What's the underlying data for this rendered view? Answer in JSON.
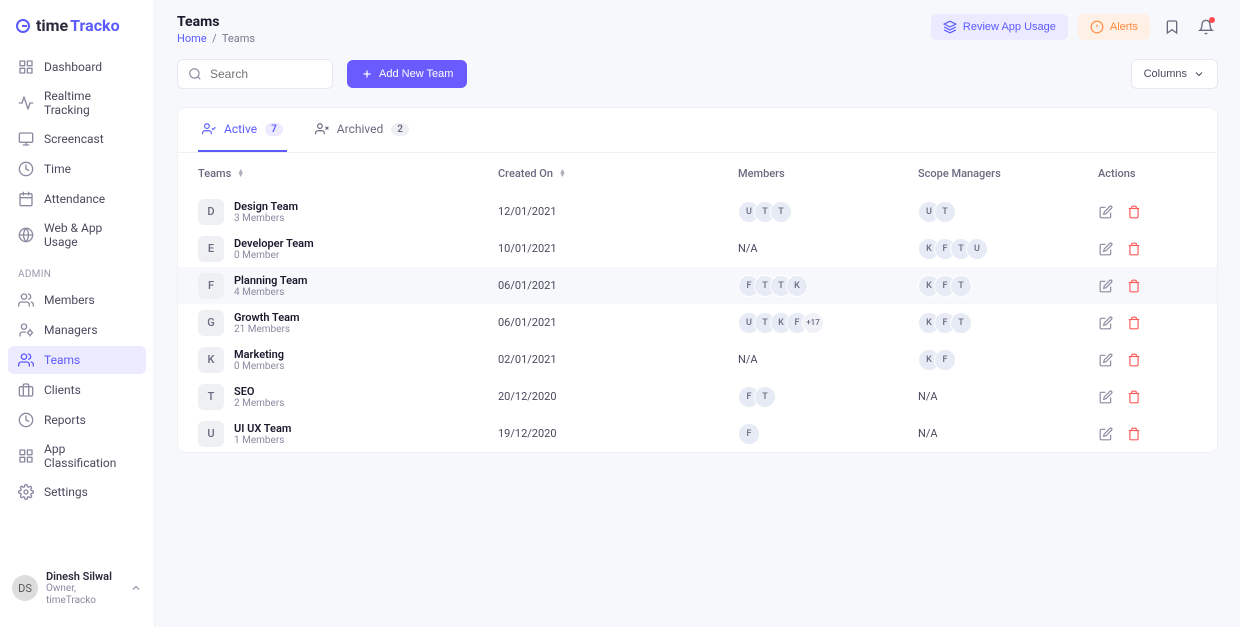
{
  "brand": {
    "part1": "time",
    "part2": "Tracko"
  },
  "nav": {
    "main": [
      {
        "label": "Dashboard",
        "icon": "grid"
      },
      {
        "label": "Realtime Tracking",
        "icon": "activity"
      },
      {
        "label": "Screencast",
        "icon": "monitor"
      },
      {
        "label": "Time",
        "icon": "clock"
      },
      {
        "label": "Attendance",
        "icon": "calendar"
      },
      {
        "label": "Web & App Usage",
        "icon": "globe"
      }
    ],
    "adminLabel": "ADMIN",
    "admin": [
      {
        "label": "Members",
        "icon": "users"
      },
      {
        "label": "Managers",
        "icon": "user-cog"
      },
      {
        "label": "Teams",
        "icon": "team",
        "active": true
      },
      {
        "label": "Clients",
        "icon": "briefcase"
      },
      {
        "label": "Reports",
        "icon": "reports"
      },
      {
        "label": "App Classification",
        "icon": "apps"
      },
      {
        "label": "Settings",
        "icon": "gear"
      }
    ]
  },
  "user": {
    "name": "Dinesh Silwal",
    "role": "Owner, timeTracko",
    "initials": "DS"
  },
  "page": {
    "title": "Teams",
    "breadcrumb": {
      "home": "Home",
      "sep": "/",
      "current": "Teams"
    }
  },
  "topActions": {
    "review": "Review App Usage",
    "alerts": "Alerts"
  },
  "toolbar": {
    "searchPlaceholder": "Search",
    "addTeam": "Add New Team",
    "columns": "Columns"
  },
  "tabs": {
    "active": {
      "label": "Active",
      "count": "7"
    },
    "archived": {
      "label": "Archived",
      "count": "2"
    }
  },
  "table": {
    "headers": {
      "teams": "Teams",
      "createdOn": "Created On",
      "members": "Members",
      "managers": "Scope Managers",
      "actions": "Actions"
    },
    "naText": "N/A",
    "rows": [
      {
        "badge": "D",
        "name": "Design Team",
        "sub": "3 Members",
        "created": "12/01/2021",
        "members": [
          "U",
          "T",
          "T"
        ],
        "managers": [
          "U",
          "T"
        ]
      },
      {
        "badge": "E",
        "name": "Developer Team",
        "sub": "0 Member",
        "created": "10/01/2021",
        "members": "na",
        "managers": [
          "K",
          "F",
          "T",
          "U"
        ]
      },
      {
        "badge": "F",
        "name": "Planning Team",
        "sub": "4 Members",
        "created": "06/01/2021",
        "members": [
          "F",
          "T",
          "T",
          "K"
        ],
        "managers": [
          "K",
          "F",
          "T"
        ],
        "hovered": true
      },
      {
        "badge": "G",
        "name": "Growth Team",
        "sub": "21 Members",
        "created": "06/01/2021",
        "members": [
          "U",
          "T",
          "K",
          "F"
        ],
        "membersMore": "+17",
        "managers": [
          "K",
          "F",
          "T"
        ]
      },
      {
        "badge": "K",
        "name": "Marketing",
        "sub": "0 Members",
        "created": "02/01/2021",
        "members": "na",
        "managers": [
          "K",
          "F"
        ]
      },
      {
        "badge": "T",
        "name": "SEO",
        "sub": "2 Members",
        "created": "20/12/2020",
        "members": [
          "F",
          "T"
        ],
        "managers": "na"
      },
      {
        "badge": "U",
        "name": "UI UX Team",
        "sub": "1 Members",
        "created": "19/12/2020",
        "members": [
          "F"
        ],
        "managers": "na"
      }
    ]
  }
}
